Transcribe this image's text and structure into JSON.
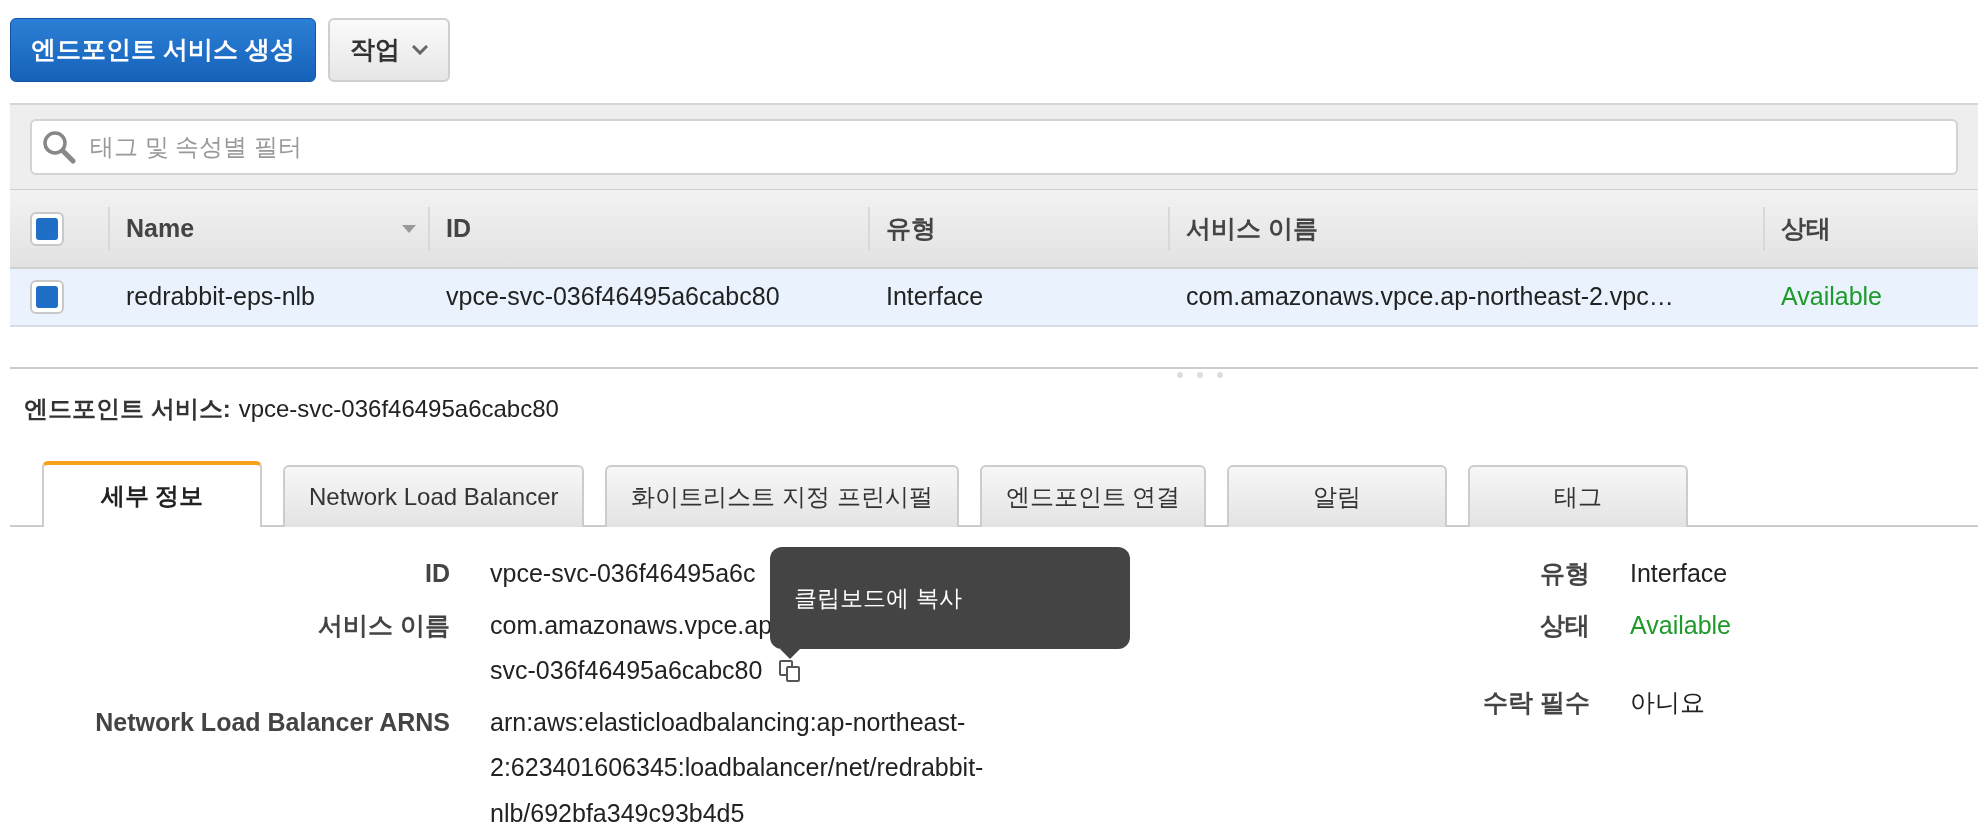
{
  "toolbar": {
    "create_button": "엔드포인트 서비스 생성",
    "actions_button": "작업"
  },
  "filter": {
    "placeholder": "태그 및 속성별 필터"
  },
  "table": {
    "select_all_checked": true,
    "columns": [
      {
        "label": "Name",
        "sortable": true,
        "kind": "text"
      },
      {
        "label": "ID",
        "sortable": false,
        "kind": "text"
      },
      {
        "label": "유형",
        "sortable": false,
        "kind": "text"
      },
      {
        "label": "서비스 이름",
        "sortable": false,
        "kind": "text"
      },
      {
        "label": "상태",
        "sortable": false,
        "kind": "status"
      }
    ],
    "rows": [
      {
        "selected": true,
        "cells": [
          "redrabbit-eps-nlb",
          "vpce-svc-036f46495a6cabc80",
          "Interface",
          "com.amazonaws.vpce.ap-northeast-2.vpc…",
          "Available"
        ]
      }
    ]
  },
  "details": {
    "title_label": "엔드포인트 서비스:",
    "title_value": "vpce-svc-036f46495a6cabc80",
    "tabs": [
      {
        "label": "세부 정보",
        "selected": true
      },
      {
        "label": "Network Load Balancer",
        "selected": false
      },
      {
        "label": "화이트리스트 지정 프린시펄",
        "selected": false
      },
      {
        "label": "엔드포인트 연결",
        "selected": false
      },
      {
        "label": "알림",
        "selected": false
      },
      {
        "label": "태그",
        "selected": false
      }
    ],
    "left_fields": [
      {
        "label": "ID",
        "lines": [
          "vpce-svc-036f46495a6c"
        ]
      },
      {
        "label": "서비스 이름",
        "lines": [
          "com.amazonaws.vpce.ap",
          "svc-036f46495a6cabc80"
        ],
        "copy": true
      },
      {
        "label": "Network Load Balancer ARNS",
        "lines": [
          "arn:aws:elasticloadbalancing:ap-northeast-",
          "2:623401606345:loadbalancer/net/redrabbit-",
          "nlb/692bfa349c93b4d5"
        ]
      }
    ],
    "right_groups": [
      [
        {
          "label": "유형",
          "value": "Interface",
          "kind": "plain"
        },
        {
          "label": "상태",
          "value": "Available",
          "kind": "ok"
        }
      ],
      [
        {
          "label": "수락 필수",
          "value": "아니요",
          "kind": "plain"
        }
      ]
    ],
    "tooltip": "클립보드에 복사"
  }
}
